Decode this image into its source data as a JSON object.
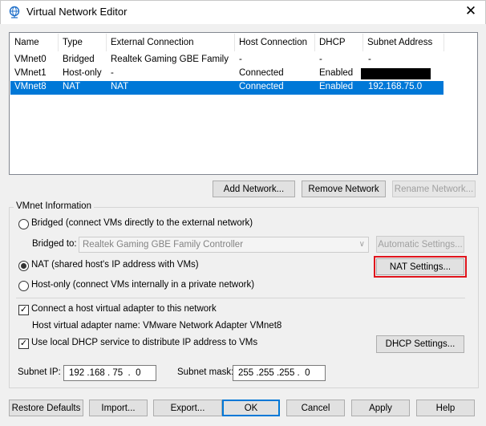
{
  "window": {
    "title": "Virtual Network Editor",
    "icon": "network-globe-icon",
    "close_glyph": "✕"
  },
  "table": {
    "columns": [
      "Name",
      "Type",
      "External Connection",
      "Host Connection",
      "DHCP",
      "Subnet Address"
    ],
    "rows": [
      {
        "name": "VMnet0",
        "type": "Bridged",
        "external": "Realtek Gaming GBE Family ...",
        "host": "-",
        "dhcp": "-",
        "subnet": "-",
        "selected": false
      },
      {
        "name": "VMnet1",
        "type": "Host-only",
        "external": "-",
        "host": "Connected",
        "dhcp": "Enabled",
        "subnet": "",
        "subnet_redacted": true,
        "selected": false
      },
      {
        "name": "VMnet8",
        "type": "NAT",
        "external": "NAT",
        "host": "Connected",
        "dhcp": "Enabled",
        "subnet": "192.168.75.0",
        "selected": true
      }
    ]
  },
  "network_buttons": {
    "add": "Add Network...",
    "remove": "Remove Network",
    "rename": "Rename Network..."
  },
  "vmnet_info": {
    "group_label": "VMnet Information",
    "bridged_label": "Bridged (connect VMs directly to the external network)",
    "bridged_to_label": "Bridged to:",
    "bridged_to_value": "Realtek Gaming GBE Family Controller",
    "auto_settings": "Automatic Settings...",
    "nat_label": "NAT (shared host's IP address with VMs)",
    "nat_settings": "NAT Settings...",
    "hostonly_label": "Host-only (connect VMs internally in a private network)",
    "selected_mode": "nat",
    "connect_adapter_label": "Connect a host virtual adapter to this network",
    "connect_adapter_checked": true,
    "adapter_name_text": "Host virtual adapter name: VMware Network Adapter VMnet8",
    "dhcp_label": "Use local DHCP service to distribute IP address to VMs",
    "dhcp_checked": true,
    "dhcp_settings": "DHCP Settings...",
    "subnet_ip_label": "Subnet IP:",
    "subnet_ip_value": "192 .168 . 75  .  0",
    "subnet_mask_label": "Subnet mask:",
    "subnet_mask_value": "255 .255 .255 .  0"
  },
  "bottom_buttons": {
    "restore": "Restore Defaults",
    "import": "Import...",
    "export": "Export...",
    "ok": "OK",
    "cancel": "Cancel",
    "apply": "Apply",
    "help": "Help"
  },
  "colors": {
    "selection": "#0078d7",
    "highlight_outline": "#e0141c"
  }
}
